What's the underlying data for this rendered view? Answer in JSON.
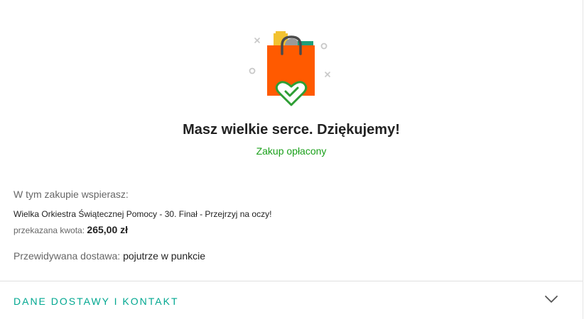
{
  "confirmation": {
    "headline": "Masz wielkie serce. Dziękujemy!",
    "status": "Zakup opłacony",
    "status_color": "#1aa01a",
    "illustration_icon": "shopping-bag-heart-icon"
  },
  "support": {
    "heading": "W tym zakupie wspierasz:",
    "campaign": "Wielka Orkiestra Świątecznej Pomocy - 30. Finał - Przejrzyj na oczy!",
    "amount_label": "przekazana kwota:",
    "amount_value": "265,00 zł"
  },
  "delivery": {
    "label": "Przewidywana dostawa:",
    "value": "pojutrze w punkcie"
  },
  "section": {
    "title": "DANE DOSTAWY I KONTAKT",
    "title_color": "#00a790",
    "icon": "chevron-down-icon"
  },
  "colors": {
    "bag": "#ff5a00",
    "heart": "#2e9e34"
  }
}
